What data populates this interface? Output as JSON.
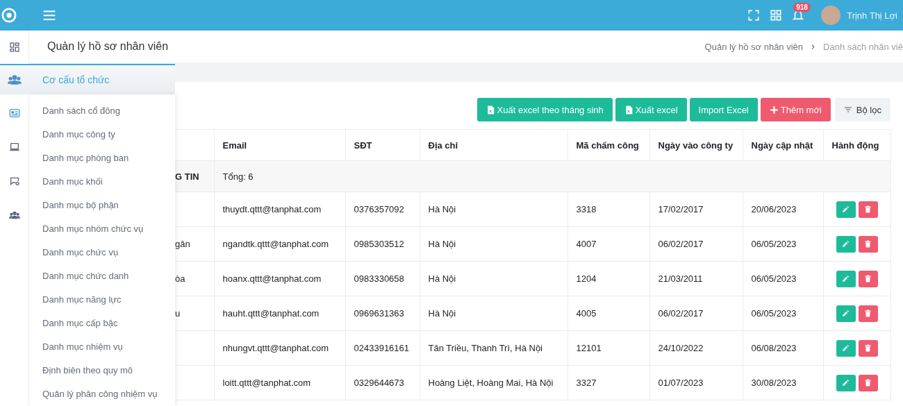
{
  "topbar": {
    "notification_count": "918",
    "user_name": "Trịnh Thị Lợi"
  },
  "rail": [
    {
      "kind": "dashboard",
      "selected": false
    },
    {
      "kind": "id-card",
      "selected": true
    },
    {
      "kind": "laptop",
      "selected": false
    },
    {
      "kind": "chat-gear",
      "selected": false
    },
    {
      "kind": "users",
      "selected": false
    }
  ],
  "page_title": "Quản lý hồ sơ nhân viên",
  "breadcrumb": [
    "Quản lý hồ sơ nhân viên",
    "Danh sách nhân viê"
  ],
  "menu": {
    "header": "Cơ cấu tổ chức",
    "items": [
      {
        "label": "Danh sách cổ đông"
      },
      {
        "label": "Danh mục công ty"
      },
      {
        "label": "Danh mục phòng ban"
      },
      {
        "label": "Danh mục khối"
      },
      {
        "label": "Danh mục bộ phận"
      },
      {
        "label": "Danh mục nhóm chức vụ"
      },
      {
        "label": "Danh mục chức vụ"
      },
      {
        "label": "Danh mục chức danh"
      },
      {
        "label": "Danh mục năng lực"
      },
      {
        "label": "Danh mục cấp bậc"
      },
      {
        "label": "Danh mục nhiệm vụ"
      },
      {
        "label": "Định biên theo quy mô"
      },
      {
        "label": "Quản lý phân công nhiệm vụ"
      }
    ]
  },
  "toolbar": [
    {
      "kind": "excel",
      "label": "Xuất excel theo tháng sinh"
    },
    {
      "kind": "excel",
      "label": "Xuất excel"
    },
    {
      "kind": "plain",
      "label": "Import Excel"
    },
    {
      "kind": "add",
      "label": "Thêm mới"
    },
    {
      "kind": "filter",
      "label": "Bộ lọc"
    }
  ],
  "table": {
    "columns": [
      "Email",
      "SĐT",
      "Địa chỉ",
      "Mã chấm công",
      "Ngày vào công ty",
      "Ngày cập nhật",
      "Hành động"
    ],
    "group_row": {
      "column_1": "G TIN",
      "total": "Tổng: 6"
    },
    "rows": [
      {
        "email": "thuydt.qttt@tanphat.com",
        "phone": "0376357092",
        "address": "Hà Nội",
        "code": "3318",
        "joined": "17/02/2017",
        "updated": "20/06/2023"
      },
      {
        "column_1": "gân",
        "email": "ngandtk.qttt@tanphat.com",
        "phone": "0985303512",
        "address": "Hà Nội",
        "code": "4007",
        "joined": "06/02/2017",
        "updated": "06/05/2023"
      },
      {
        "column_1": "òa",
        "email": "hoanx.qttt@tanphat.com",
        "phone": "0983330658",
        "address": "Hà Nội",
        "code": "1204",
        "joined": "21/03/2011",
        "updated": "06/05/2023"
      },
      {
        "column_1": "u",
        "email": "hauht.qttt@tanphat.com",
        "phone": "0969631363",
        "address": "Hà Nội",
        "code": "4005",
        "joined": "06/02/2017",
        "updated": "06/05/2023"
      },
      {
        "email": "nhungvt.qttt@tanphat.com",
        "phone": "02433916161",
        "address": "Tân Triều, Thanh Trì, Hà Nội",
        "code": "12101",
        "joined": "24/10/2022",
        "updated": "06/08/2023"
      },
      {
        "email": "loitt.qttt@tanphat.com",
        "phone": "0329644673",
        "address": "Hoàng Liệt, Hoàng Mai, Hà Nội",
        "code": "3327",
        "joined": "01/07/2023",
        "updated": "30/08/2023"
      }
    ]
  }
}
